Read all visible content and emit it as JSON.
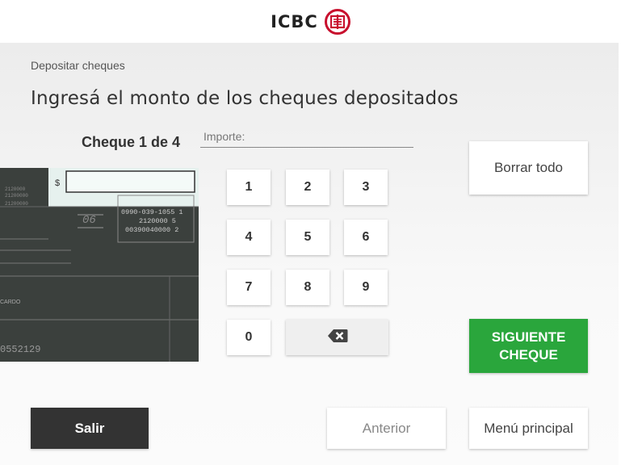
{
  "brand": {
    "name": "ICBC",
    "accent": "#c8102e"
  },
  "breadcrumb": "Depositar cheques",
  "title": "Ingresá el monto de los cheques depositados",
  "cheque": {
    "counter": "Cheque 1 de 4",
    "image_texts": {
      "dollar": "$",
      "routing1": "0990-039-1055 1",
      "routing2": "2120000 5",
      "routing3": "00390040000 2",
      "date_day": "06",
      "payee_hint": "CARDO",
      "serial": "0552129"
    }
  },
  "amount": {
    "label": "Importe:",
    "value": ""
  },
  "keypad": {
    "keys": [
      "1",
      "2",
      "3",
      "4",
      "5",
      "6",
      "7",
      "8",
      "9",
      "0"
    ],
    "backspace_icon": "backspace-icon"
  },
  "actions": {
    "clear_all": "Borrar todo",
    "next_cheque": "SIGUIENTE\nCHEQUE",
    "exit": "Salir",
    "previous": "Anterior",
    "main_menu": "Menú principal"
  },
  "colors": {
    "primary_green": "#2aa63c",
    "dark_button": "#333333",
    "brand_red": "#c8102e"
  }
}
